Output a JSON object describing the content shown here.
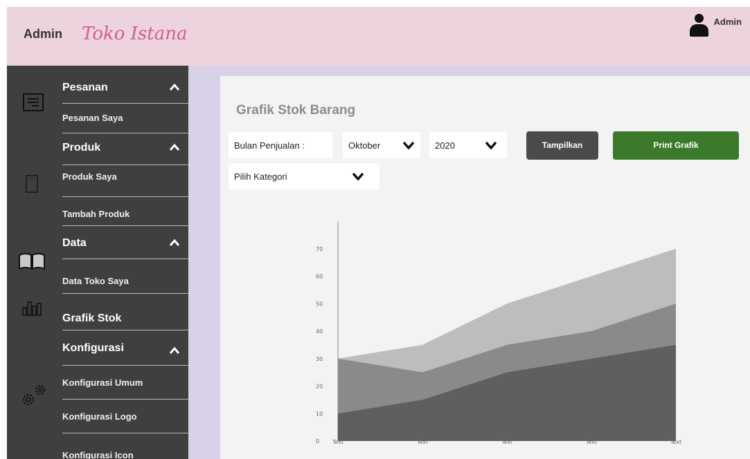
{
  "header": {
    "admin_label": "Admin",
    "store_name": "Toko Istana",
    "user_name": "Admin"
  },
  "sidebar": {
    "sections": [
      {
        "label": "Pesanan",
        "items": [
          "Pesanan Saya"
        ]
      },
      {
        "label": "Produk",
        "items": [
          "Produk Saya",
          "Tambah Produk"
        ]
      },
      {
        "label": "Data",
        "items": [
          "Data Toko Saya"
        ]
      },
      {
        "label": "Grafik Stok",
        "items": []
      },
      {
        "label": "Konfigurasi",
        "items": [
          "Konfigurasi Umum",
          "Konfigurasi Logo",
          "Konfigurasi Icon"
        ]
      }
    ]
  },
  "main": {
    "title": "Grafik Stok Barang",
    "month_label": "Bulan Penjualan :",
    "month_value": "Oktober",
    "year_value": "2020",
    "category_placeholder": "Pilih Kategori",
    "show_button": "Tampilkan",
    "print_button": "Print Grafik"
  },
  "chart_data": {
    "type": "area",
    "categories": [
      "Text",
      "Text",
      "Text",
      "Text",
      "Text"
    ],
    "y_ticks": [
      "0",
      "10",
      "20",
      "30",
      "40",
      "50",
      "60",
      "70"
    ],
    "ylim": [
      0,
      80
    ],
    "series": [
      {
        "values": [
          10,
          15,
          25,
          30,
          35
        ],
        "color": "#5f5f5f"
      },
      {
        "values": [
          30,
          25,
          35,
          40,
          50
        ],
        "color": "#8a8a8a"
      },
      {
        "values": [
          30,
          35,
          50,
          60,
          70
        ],
        "color": "#bdbdbd"
      }
    ]
  }
}
